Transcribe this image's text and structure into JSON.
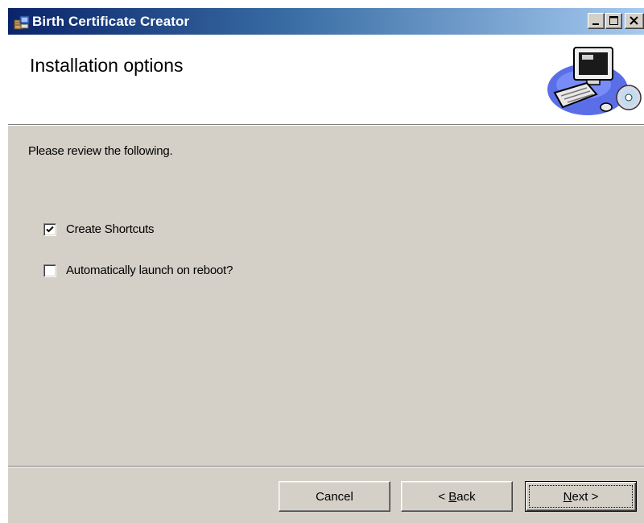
{
  "window": {
    "title": "Birth Certificate Creator",
    "controls": [
      "minimize-icon",
      "maximize-icon",
      "close-icon"
    ]
  },
  "banner": {
    "heading": "Installation options",
    "art_icon": "computer-with-cd-icon"
  },
  "body": {
    "prompt": "Please review the following.",
    "options": [
      {
        "label": "Create Shortcuts",
        "checked": true
      },
      {
        "label": "Automatically launch on reboot?",
        "checked": false
      }
    ]
  },
  "buttons": {
    "cancel": "Cancel",
    "back_prefix": "< ",
    "back_mnemonic": "B",
    "back_rest": "ack",
    "next_mnemonic": "N",
    "next_rest": "ext >",
    "default": "next"
  },
  "colors": {
    "titlebar_start": "#0a246a",
    "titlebar_end": "#a6caf0",
    "face": "#d4d0c8"
  }
}
